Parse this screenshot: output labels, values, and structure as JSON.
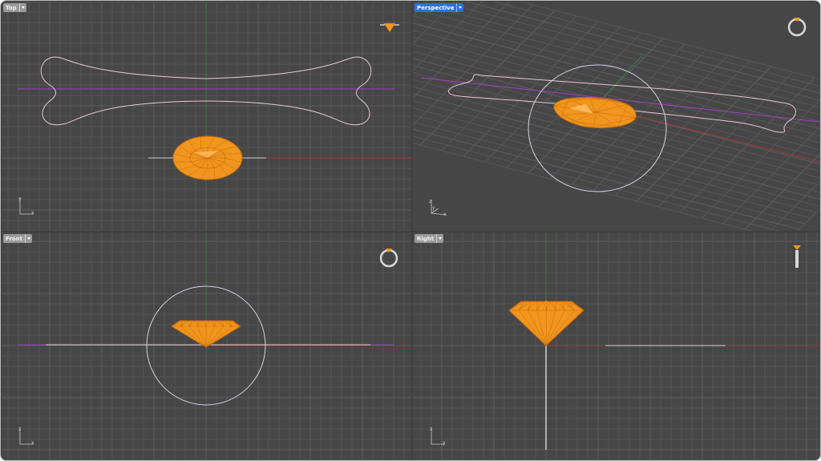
{
  "viewports": [
    {
      "id": "top",
      "label": "Top",
      "active": false,
      "axes": [
        "y",
        "x"
      ],
      "preview_icon": "gem-preview-icon"
    },
    {
      "id": "perspective",
      "label": "Perspective",
      "active": true,
      "axes": [
        "z",
        "y",
        "x"
      ],
      "preview_icon": "ring-preview-icon"
    },
    {
      "id": "front",
      "label": "Front",
      "active": false,
      "axes": [
        "z",
        "x"
      ],
      "preview_icon": "ring-preview-icon"
    },
    {
      "id": "right",
      "label": "Right",
      "active": false,
      "axes": [
        "z",
        "y"
      ],
      "preview_icon": "ring-side-preview-icon"
    }
  ],
  "colors": {
    "background": "#464646",
    "grid": "#545454",
    "grid_major": "#5e5e5e",
    "axis_x": "#a03a3a",
    "axis_y": "#3f7a3f",
    "curve": "#e8c8d0",
    "selected_line": "#a040c0",
    "gem": "#f0961e",
    "gem_edge": "#c86a08",
    "tab_active": "#2d6fe6",
    "tab_inactive": "#9a9a9a"
  }
}
